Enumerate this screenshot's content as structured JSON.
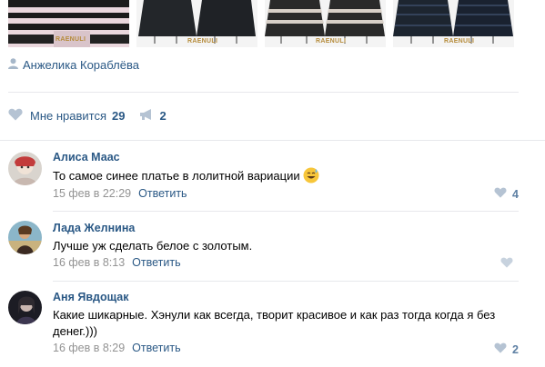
{
  "photos": {
    "brand": "RAENULI",
    "brand_sub": "FEATURE DESIGN"
  },
  "post": {
    "author": "Анжелика Кораблёва",
    "likes_label": "Мне нравится",
    "likes_count": "29",
    "shares_count": "2"
  },
  "comments": [
    {
      "name": "Алиса Маас",
      "text": "То самое синее платье в лолитной вариации",
      "date": "15 фев в 22:29",
      "reply": "Ответить",
      "likes": "4"
    },
    {
      "name": "Лада Желнина",
      "text": "Лучше уж сделать белое с золотым.",
      "date": "16 фев в 8:13",
      "reply": "Ответить",
      "likes": ""
    },
    {
      "name": "Аня Явдощак",
      "text": "Какие шикарные. Хэнули как всегда, творит красивое и как раз тогда когда я без денег.)))",
      "date": "16 фев в 8:29",
      "reply": "Ответить",
      "likes": "2"
    }
  ],
  "colors": {
    "link": "#2a5885",
    "meta": "#939393",
    "separator": "#e7e8ec",
    "like_icon": "#b5c3d3"
  }
}
